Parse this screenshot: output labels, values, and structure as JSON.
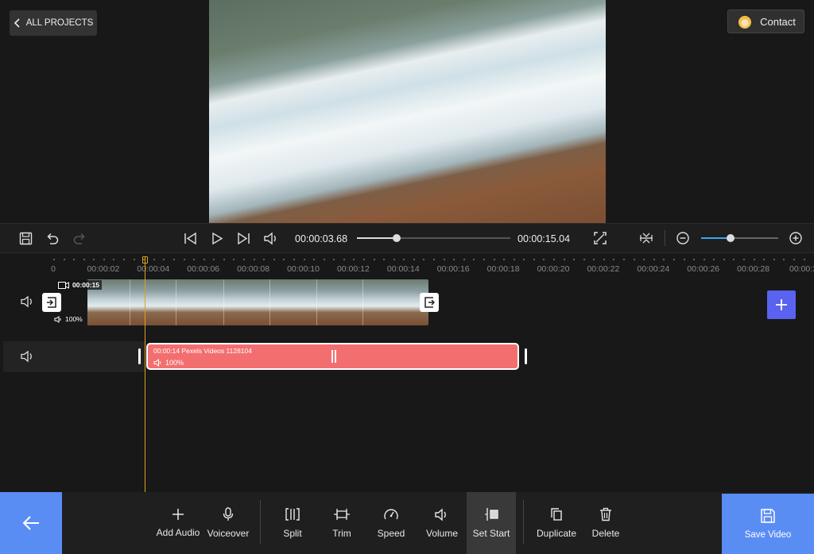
{
  "header": {
    "back_label": "ALL PROJECTS",
    "contact_label": "Contact"
  },
  "player": {
    "current_time": "00:00:03.68",
    "total_time": "00:00:15.04",
    "seek_progress": 0.26,
    "zoom_level": 0.38
  },
  "ruler": {
    "labels": [
      "0",
      "00:00:02",
      "00:00:04",
      "00:00:06",
      "00:00:08",
      "00:00:10",
      "00:00:12",
      "00:00:14",
      "00:00:16",
      "00:00:18",
      "00:00:20",
      "00:00:22",
      "00:00:24",
      "00:00:26",
      "00:00:28",
      "00:00:3"
    ]
  },
  "video_track": {
    "duration": "00:00:15",
    "volume": "100%"
  },
  "audio_track": {
    "title": "00:00:14  Pexels Videos 1128104",
    "volume": "100%"
  },
  "toolbar": {
    "add_audio": "Add Audio",
    "voiceover": "Voiceover",
    "split": "Split",
    "trim": "Trim",
    "speed": "Speed",
    "volume": "Volume",
    "set_start": "Set Start",
    "duplicate": "Duplicate",
    "delete": "Delete",
    "save_video": "Save Video"
  },
  "colors": {
    "accent_blue": "#5a8df4",
    "audio_clip": "#f36f6f",
    "add_button": "#5a62f0",
    "playhead": "#e0a020",
    "zoom_fill": "#3ba6ee"
  }
}
